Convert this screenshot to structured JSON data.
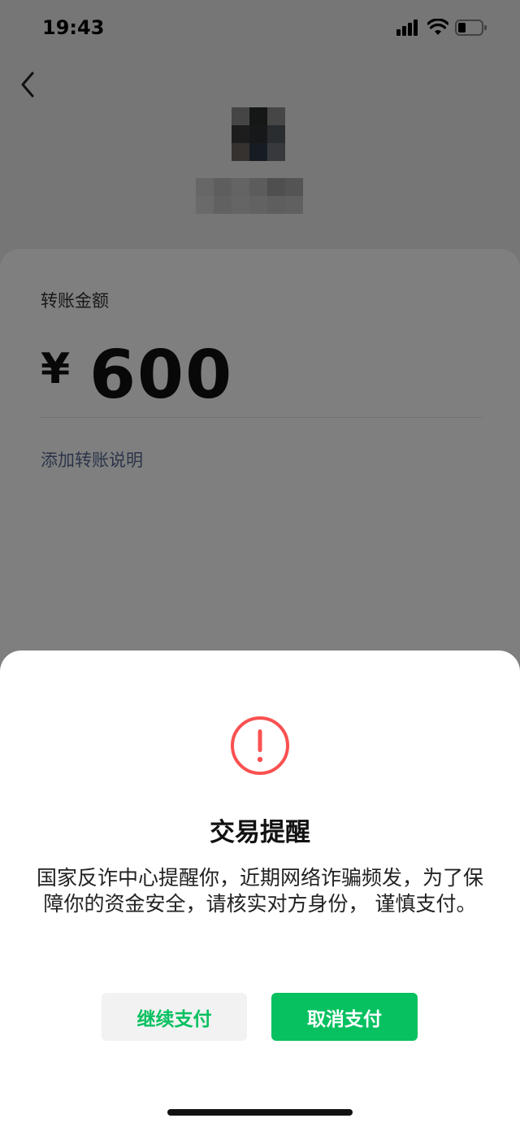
{
  "status_bar": {
    "time": "19:43"
  },
  "transfer": {
    "amount_label": "转账金额",
    "currency_symbol": "¥",
    "amount": "600",
    "add_note_link": "添加转账说明"
  },
  "dialog": {
    "title": "交易提醒",
    "message": "国家反诈中心提醒你，近期网络诈骗频发，为了保障你的资金安全，请核实对方身份， 谨慎支付。",
    "continue_button": "继续支付",
    "cancel_button": "取消支付"
  },
  "icons": {
    "back": "chevron-left-icon",
    "warning": "exclamation-circle-icon",
    "signal": "cellular-signal-icon",
    "wifi": "wifi-icon",
    "battery": "battery-icon"
  },
  "colors": {
    "accent_green": "#07c160",
    "link_blue": "#576b95",
    "warning_red": "#fa5151"
  }
}
